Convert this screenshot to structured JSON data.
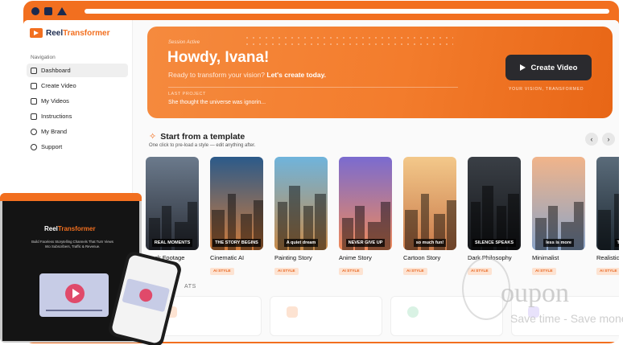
{
  "brand": {
    "name_part1": "Reel",
    "name_part2": "Transformer"
  },
  "sidebar": {
    "heading": "Navigation",
    "items": [
      {
        "label": "Dashboard",
        "icon": "home-icon"
      },
      {
        "label": "Create Video",
        "icon": "video-icon"
      },
      {
        "label": "My Videos",
        "icon": "folder-icon"
      },
      {
        "label": "Instructions",
        "icon": "book-icon"
      },
      {
        "label": "My Brand",
        "icon": "palette-icon"
      },
      {
        "label": "Support",
        "icon": "headset-icon"
      }
    ]
  },
  "hero": {
    "session": "Session Active",
    "greeting": "Howdy, Ivana!",
    "tagline_prefix": "Ready to transform your vision?",
    "tagline_cta": "Let's create today.",
    "last_label": "LAST PROJECT",
    "last_title": "She thought the universe was ignorin...",
    "create_button": "Create Video",
    "slogan": "YOUR VISION, TRANSFORMED"
  },
  "templates": {
    "title": "Start from a template",
    "subtitle": "One click to pre-load a style — edit anything after.",
    "prev": "‹",
    "next": "›",
    "items": [
      {
        "name": "Stock Footage",
        "badge": "AI STYLE",
        "caption": "REAL MOMENTS",
        "colors": [
          "#6b7a8c",
          "#2b2f38"
        ]
      },
      {
        "name": "Cinematic AI",
        "badge": "AI STYLE",
        "caption": "THE STORY BEGINS",
        "colors": [
          "#2b5a8a",
          "#d07b3a"
        ]
      },
      {
        "name": "Painting Story",
        "badge": "AI STYLE",
        "caption": "A quiet dream",
        "colors": [
          "#6fb4dc",
          "#c88b4a"
        ]
      },
      {
        "name": "Anime Story",
        "badge": "AI STYLE",
        "caption": "NEVER GIVE UP",
        "colors": [
          "#7a6bd0",
          "#f08a5a"
        ]
      },
      {
        "name": "Cartoon Story",
        "badge": "AI STYLE",
        "caption": "so much fun!",
        "colors": [
          "#f3c88a",
          "#c97a4a"
        ]
      },
      {
        "name": "Dark Philosophy",
        "badge": "AI STYLE",
        "caption": "SILENCE SPEAKS",
        "colors": [
          "#3a3f46",
          "#15171a"
        ]
      },
      {
        "name": "Minimalist",
        "badge": "AI STYLE",
        "caption": "less is more",
        "colors": [
          "#f1b48a",
          "#8aa4c8"
        ]
      },
      {
        "name": "Realistic Cinema",
        "badge": "AI STYLE",
        "caption": "TRUE",
        "colors": [
          "#5a6b7a",
          "#1f2a33"
        ]
      }
    ]
  },
  "stats": {
    "label": "ATS"
  },
  "promo": {
    "logo_part1": "Reel",
    "logo_part2": "Transformer",
    "subtitle": "Build Faceless Storytelling Channels That Turn Views Into Subscribers, Traffic & Revenue."
  },
  "watermark": {
    "brand": "oupon",
    "tagline": "Save time - Save money"
  },
  "colors": {
    "accent": "#f26f1f",
    "dark": "#2a2a2e",
    "badge_bg": "#fde3d2"
  }
}
